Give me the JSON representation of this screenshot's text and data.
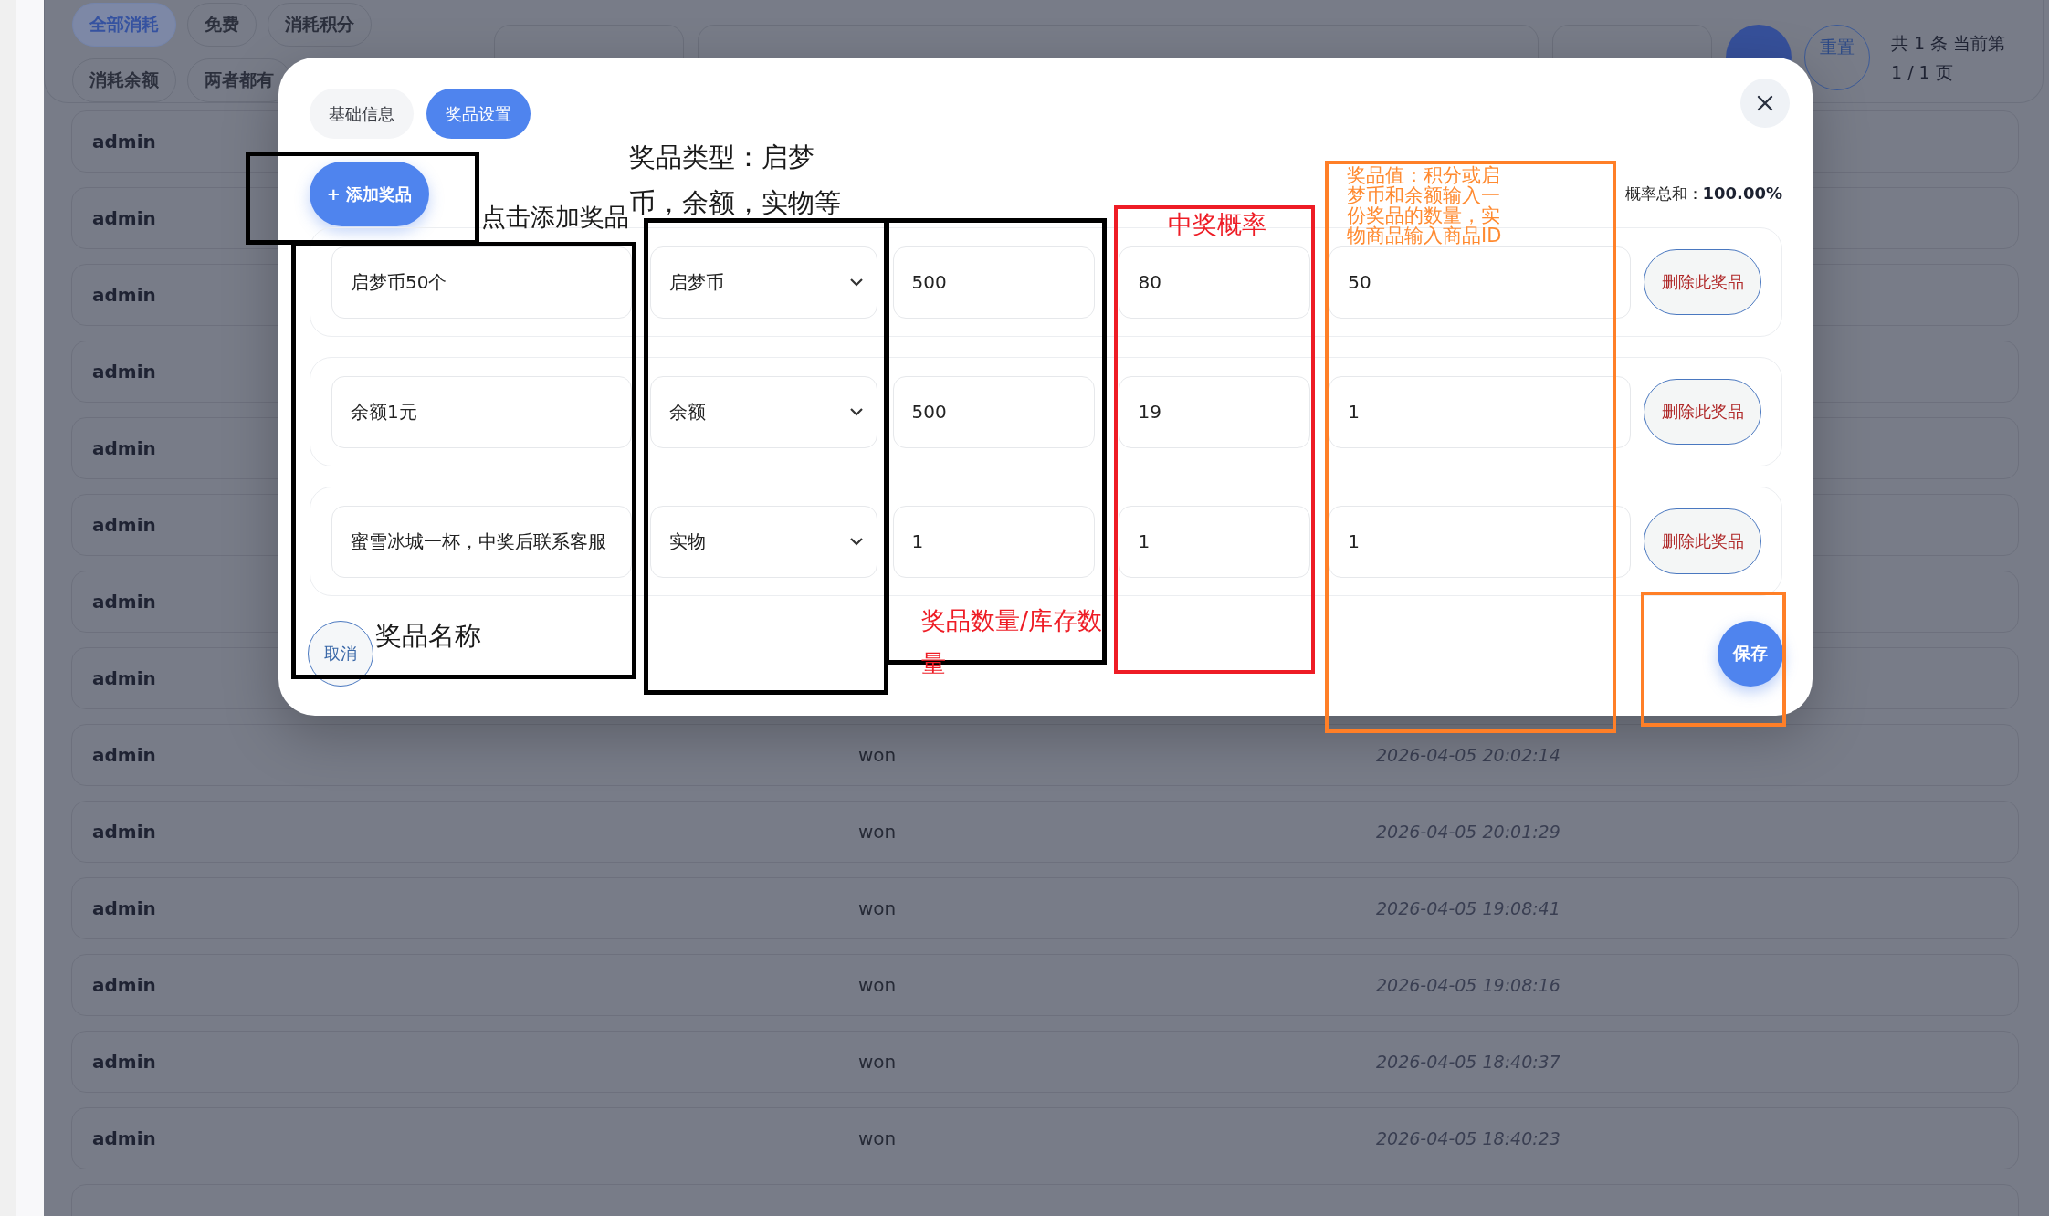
{
  "filter_chips": [
    {
      "label": "全部消耗",
      "selected": true
    },
    {
      "label": "免费",
      "selected": false
    },
    {
      "label": "消耗积分",
      "selected": false
    },
    {
      "label": "消耗余额",
      "selected": false
    },
    {
      "label": "两者都有",
      "selected": false
    }
  ],
  "reset_button": "重置",
  "page_info": "共 1 条 当前第 1 / 1 页",
  "records": [
    {
      "user": "admin"
    },
    {
      "user": "admin"
    },
    {
      "user": "admin"
    },
    {
      "user": "admin"
    },
    {
      "user": "admin"
    },
    {
      "user": "admin"
    },
    {
      "user": "admin"
    },
    {
      "user": "admin"
    },
    {
      "user": "admin",
      "result": "won",
      "time": "2026-04-05 20:02:14"
    },
    {
      "user": "admin",
      "result": "won",
      "time": "2026-04-05 20:01:29"
    },
    {
      "user": "admin",
      "result": "won",
      "time": "2026-04-05 19:08:41"
    },
    {
      "user": "admin",
      "result": "won",
      "time": "2026-04-05 19:08:16"
    },
    {
      "user": "admin",
      "result": "won",
      "time": "2026-04-05 18:40:37"
    },
    {
      "user": "admin",
      "result": "won",
      "time": "2026-04-05 18:40:23"
    }
  ],
  "modal": {
    "tabs": [
      {
        "label": "基础信息",
        "selected": false
      },
      {
        "label": "奖品设置",
        "selected": true
      }
    ],
    "add_button": "+ 添加奖品",
    "probability_total": {
      "label": "概率总和：",
      "value": "100.00%"
    },
    "prizes": [
      {
        "name": "启梦币50个",
        "type": "启梦币",
        "quantity": "500",
        "probability": "80",
        "value": "50",
        "delete_button": "删除此奖品"
      },
      {
        "name": "余额1元",
        "type": "余额",
        "quantity": "500",
        "probability": "19",
        "value": "1",
        "delete_button": "删除此奖品"
      },
      {
        "name": "蜜雪冰城一杯，中奖后联系客服",
        "type": "实物",
        "quantity": "1",
        "probability": "1",
        "value": "1",
        "delete_button": "删除此奖品"
      }
    ],
    "cancel_button": "取消",
    "save_button": "保存"
  },
  "annotations": {
    "boxes": [
      {
        "color": "#000000"
      },
      {
        "color": "#000000"
      },
      {
        "color": "#000000"
      },
      {
        "color": "#000000"
      },
      {
        "color": "#ee1c25"
      },
      {
        "color": "#ff7f27"
      },
      {
        "color": "#ff7f27"
      }
    ],
    "notes": [
      {
        "text": "奖品类型：启梦币，余额，实物等",
        "color": "#1a1a1a"
      },
      {
        "text": "点击添加奖品",
        "color": "#1a1a1a"
      },
      {
        "text": "中奖概率",
        "color": "#ee1c25"
      },
      {
        "text": "奖品值：积分或启梦币和余额输入一份奖品的数量，实物商品输入商品ID",
        "color": "#ff8a30"
      },
      {
        "text": "奖品名称",
        "color": "#1a1a1a"
      },
      {
        "text": "奖品数量/库存数量",
        "color": "#ee1c25"
      }
    ]
  }
}
